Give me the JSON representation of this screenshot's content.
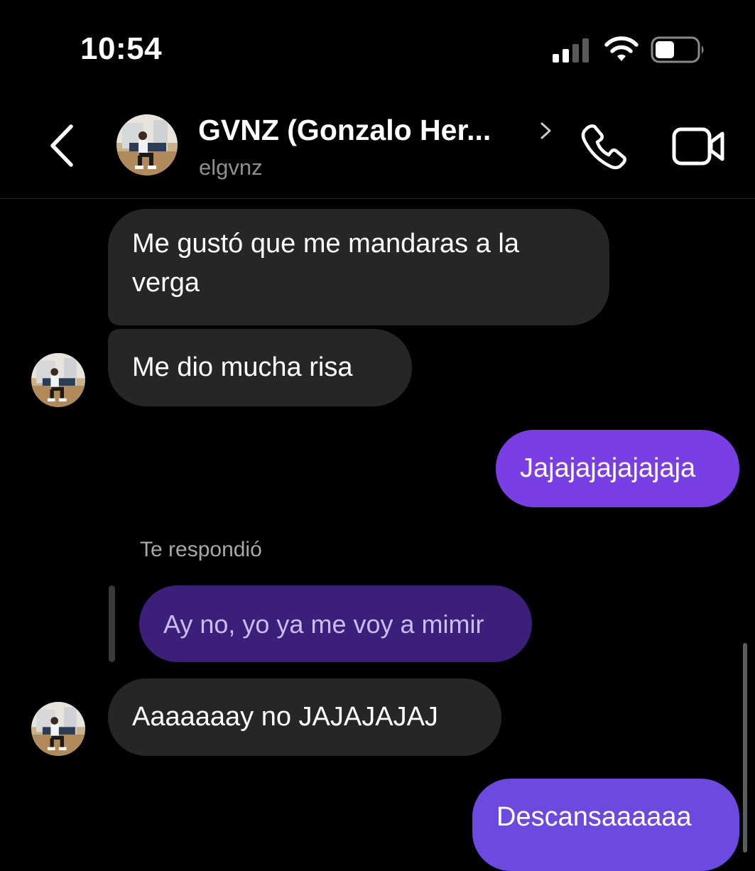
{
  "status_bar": {
    "time": "10:54",
    "signal_icon": "cellular-signal-icon",
    "wifi_icon": "wifi-icon",
    "battery_icon": "battery-icon",
    "battery_level": 0.4
  },
  "header": {
    "name": "GVNZ (Gonzalo Her...",
    "username": "elgvnz",
    "back_icon": "chevron-left-icon",
    "call_icon": "phone-icon",
    "video_icon": "video-camera-icon"
  },
  "messages": [
    {
      "direction": "incoming",
      "text": "Me gustó que me mandaras a la verga"
    },
    {
      "direction": "incoming",
      "text": "Me dio mucha risa"
    },
    {
      "direction": "outgoing",
      "text": "Jajajajajajajaja"
    },
    {
      "direction": "incoming",
      "reply_label": "Te respondió",
      "quoted_text": "Ay no, yo ya me voy a mimir",
      "text": "Aaaaaaay no JAJAJAJAJ"
    },
    {
      "direction": "outgoing",
      "text": "Descansaaaaaa"
    }
  ],
  "colors": {
    "background": "#000000",
    "incoming_bubble": "#262626",
    "outgoing_bubble_1": "#7a3fe4",
    "outgoing_bubble_2": "#6c4ae0",
    "quoted_bubble": "#3b1f7a",
    "secondary_text": "#8e8e93"
  }
}
